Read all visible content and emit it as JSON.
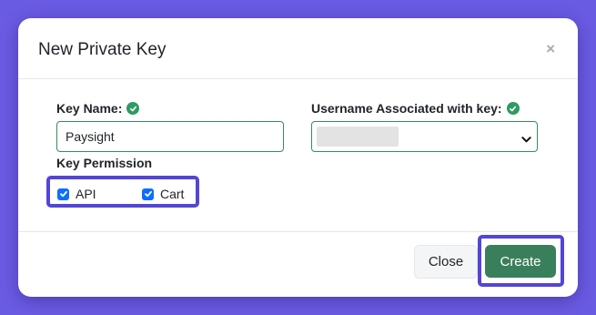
{
  "modal": {
    "title": "New Private Key",
    "close_icon": "×"
  },
  "form": {
    "key_name_label": "Key Name:",
    "key_name_value": "Paysight",
    "username_label": "Username Associated with key:",
    "username_selected": "",
    "permission_label": "Key Permission",
    "permissions": [
      {
        "label": "API",
        "checked": true
      },
      {
        "label": "Cart",
        "checked": true
      }
    ]
  },
  "footer": {
    "close_label": "Close",
    "create_label": "Create"
  },
  "icons": {
    "valid": "check-circle-icon",
    "checkbox": "checkbox-checked-icon",
    "dropdown": "chevron-down-icon"
  },
  "colors": {
    "backdrop": "#6a5be3",
    "highlight": "#5345d6",
    "valid_green": "#2e9b62",
    "primary_button": "#3a7f5b",
    "checkbox": "#0d6efd"
  }
}
